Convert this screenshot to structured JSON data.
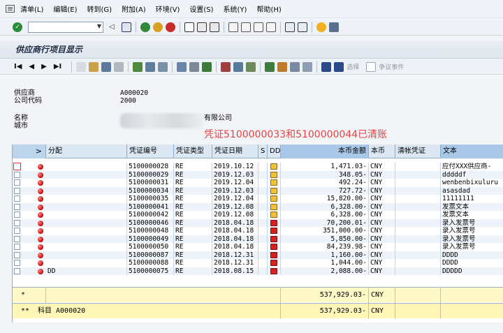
{
  "menu": [
    "清单(L)",
    "编辑(E)",
    "转到(G)",
    "附加(A)",
    "环境(V)",
    "设置(S)",
    "系统(Y)",
    "帮助(H)"
  ],
  "title": "供应商行项目显示",
  "app_toolbar": {
    "select_label": "选择",
    "event_label": "争议事件"
  },
  "header": {
    "vendor_label": "供应商",
    "vendor_value": "A000020",
    "company_label": "公司代码",
    "company_value": "2000",
    "name_label": "名称",
    "name_value": "有限公司",
    "city_label": "城市"
  },
  "notice": "凭证5100000033和5100000044已清账",
  "columns": [
    "分配",
    "凭证编号",
    "凭证类型",
    "凭证日期",
    "S",
    "DD",
    "本币金额",
    "本币",
    "清帐凭证",
    "文本"
  ],
  "rows": [
    {
      "assign": "",
      "doc": "5100000028",
      "type": "RE",
      "date": "2019.10.12",
      "dd": "open",
      "amount": "1,471.03-",
      "cur": "CNY",
      "text": "应付XXX供应商-"
    },
    {
      "assign": "",
      "doc": "5100000029",
      "type": "RE",
      "date": "2019.12.03",
      "dd": "open",
      "amount": "348.05-",
      "cur": "CNY",
      "text": "dddddf"
    },
    {
      "assign": "",
      "doc": "5100000031",
      "type": "RE",
      "date": "2019.12.04",
      "dd": "open",
      "amount": "492.24-",
      "cur": "CNY",
      "text": "wenbenbixuluru"
    },
    {
      "assign": "",
      "doc": "5100000034",
      "type": "RE",
      "date": "2019.12.03",
      "dd": "open",
      "amount": "727.72-",
      "cur": "CNY",
      "text": "asasdad"
    },
    {
      "assign": "",
      "doc": "5100000035",
      "type": "RE",
      "date": "2019.12.04",
      "dd": "open",
      "amount": "15,820.00-",
      "cur": "CNY",
      "text": "11111111"
    },
    {
      "assign": "",
      "doc": "5100000041",
      "type": "RE",
      "date": "2019.12.08",
      "dd": "open",
      "amount": "6,328.00-",
      "cur": "CNY",
      "text": "发票文本"
    },
    {
      "assign": "",
      "doc": "5100000042",
      "type": "RE",
      "date": "2019.12.08",
      "dd": "open",
      "amount": "6,328.00-",
      "cur": "CNY",
      "text": "发票文本"
    },
    {
      "assign": "",
      "doc": "5100000046",
      "type": "RE",
      "date": "2018.04.18",
      "dd": "lock",
      "amount": "70,200.01-",
      "cur": "CNY",
      "text": "录入发票号"
    },
    {
      "assign": "",
      "doc": "5100000048",
      "type": "RE",
      "date": "2018.04.18",
      "dd": "lock",
      "amount": "351,000.00-",
      "cur": "CNY",
      "text": "录入发票号"
    },
    {
      "assign": "",
      "doc": "5100000049",
      "type": "RE",
      "date": "2018.04.18",
      "dd": "lock",
      "amount": "5,850.00-",
      "cur": "CNY",
      "text": "录入发票号"
    },
    {
      "assign": "",
      "doc": "5100000050",
      "type": "RE",
      "date": "2018.04.18",
      "dd": "lock",
      "amount": "84,239.98-",
      "cur": "CNY",
      "text": "录入发票号"
    },
    {
      "assign": "",
      "doc": "5100000087",
      "type": "RE",
      "date": "2018.12.31",
      "dd": "lock",
      "amount": "1,160.00-",
      "cur": "CNY",
      "text": "DDDD"
    },
    {
      "assign": "",
      "doc": "5100000088",
      "type": "RE",
      "date": "2018.12.31",
      "dd": "lock",
      "amount": "1,044.00-",
      "cur": "CNY",
      "text": "DDDD"
    },
    {
      "assign": "DD",
      "doc": "5100000075",
      "type": "RE",
      "date": "2018.08.15",
      "dd": "lock",
      "amount": "2,088.00-",
      "cur": "CNY",
      "text": "DDDDD"
    }
  ],
  "total": {
    "marker": "*",
    "amount": "537,929.03-",
    "cur": "CNY"
  },
  "subtotal": {
    "marker": "**",
    "label": "科目 A000020",
    "amount": "537,929.03-",
    "cur": "CNY"
  }
}
